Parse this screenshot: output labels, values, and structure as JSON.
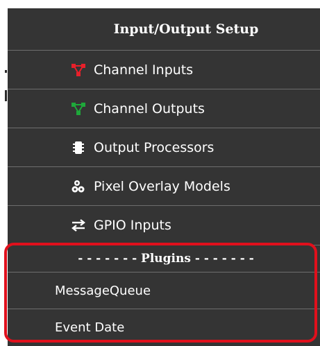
{
  "menu": {
    "title": "Input/Output Setup",
    "items": [
      {
        "label": "Channel Inputs",
        "icon": "channel-inputs-icon",
        "icon_color": "#e8202a"
      },
      {
        "label": "Channel Outputs",
        "icon": "channel-outputs-icon",
        "icon_color": "#1ea83a"
      },
      {
        "label": "Output Processors",
        "icon": "output-processors-icon",
        "icon_color": "#ffffff"
      },
      {
        "label": "Pixel Overlay Models",
        "icon": "pixel-overlay-icon",
        "icon_color": "#ffffff"
      },
      {
        "label": "GPIO Inputs",
        "icon": "gpio-inputs-icon",
        "icon_color": "#ffffff"
      }
    ],
    "plugins": {
      "header": "- - - - - - - Plugins - - - - - - -",
      "items": [
        {
          "label": "MessageQueue"
        },
        {
          "label": "Event Date"
        }
      ]
    }
  },
  "colors": {
    "menu_background": "#343434",
    "divider": "#6e6e6e",
    "text": "#ffffff",
    "highlight_border": "#e0101c"
  }
}
